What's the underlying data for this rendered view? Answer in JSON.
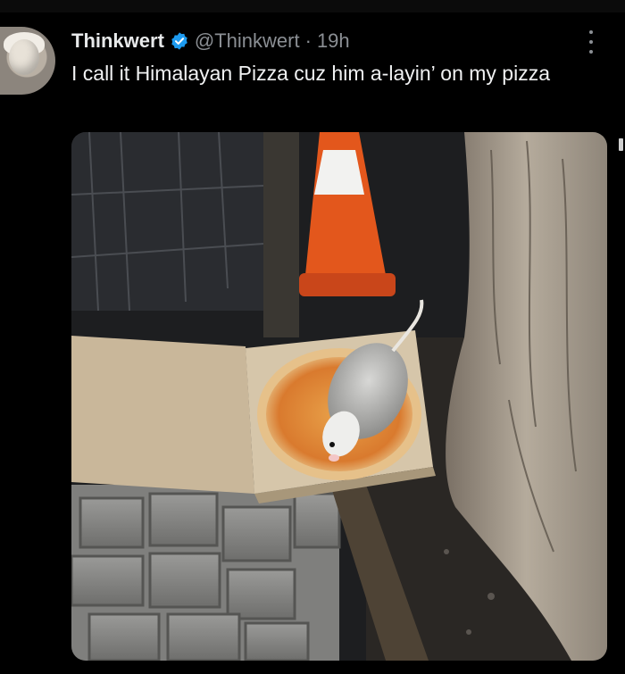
{
  "tweet": {
    "author_name": "Thinkwert",
    "handle": "@Thinkwert",
    "separator": "·",
    "timestamp": "19h",
    "verified": true,
    "text": "I call it Himalayan Pizza cuz him a-layin’ on my pizza"
  },
  "icons": {
    "verified": "verified-badge-icon",
    "more": "more-options-icon"
  },
  "colors": {
    "background": "#000000",
    "verified_blue": "#1d9bf0",
    "text_primary": "#e7e9ea",
    "text_secondary": "#8b8f94"
  }
}
